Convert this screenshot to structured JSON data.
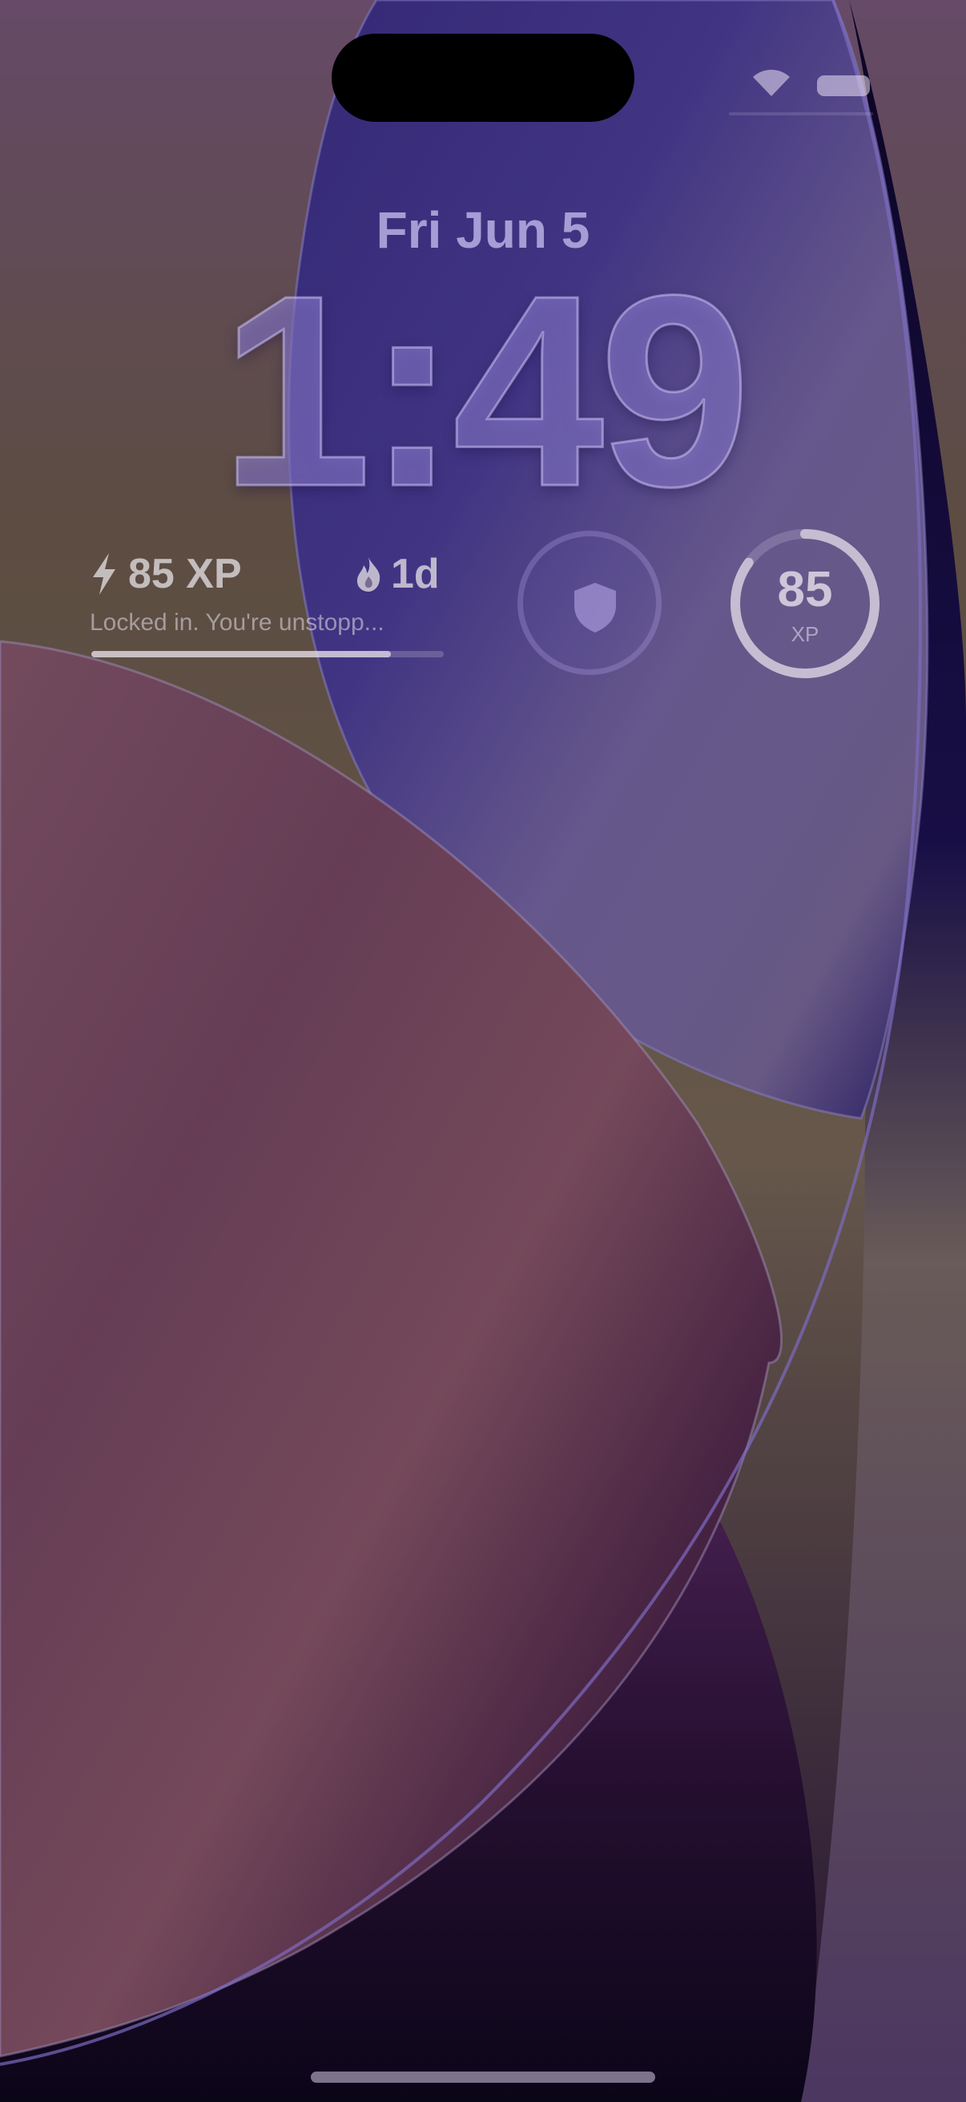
{
  "lock_screen": {
    "date": "Fri Jun 5",
    "time": "1:49"
  },
  "widgets": {
    "xp_label": "85 XP",
    "streak_label": "1d",
    "status_message": "Locked in. You're unstopp...",
    "progress_fraction": 0.85,
    "ring_value": "85",
    "ring_unit": "XP",
    "ring_fraction": 0.85
  },
  "icons": {
    "bolt": "bolt-icon",
    "flame": "flame-icon",
    "shield": "shield-icon",
    "wifi": "wifi-icon",
    "battery": "battery-icon"
  }
}
